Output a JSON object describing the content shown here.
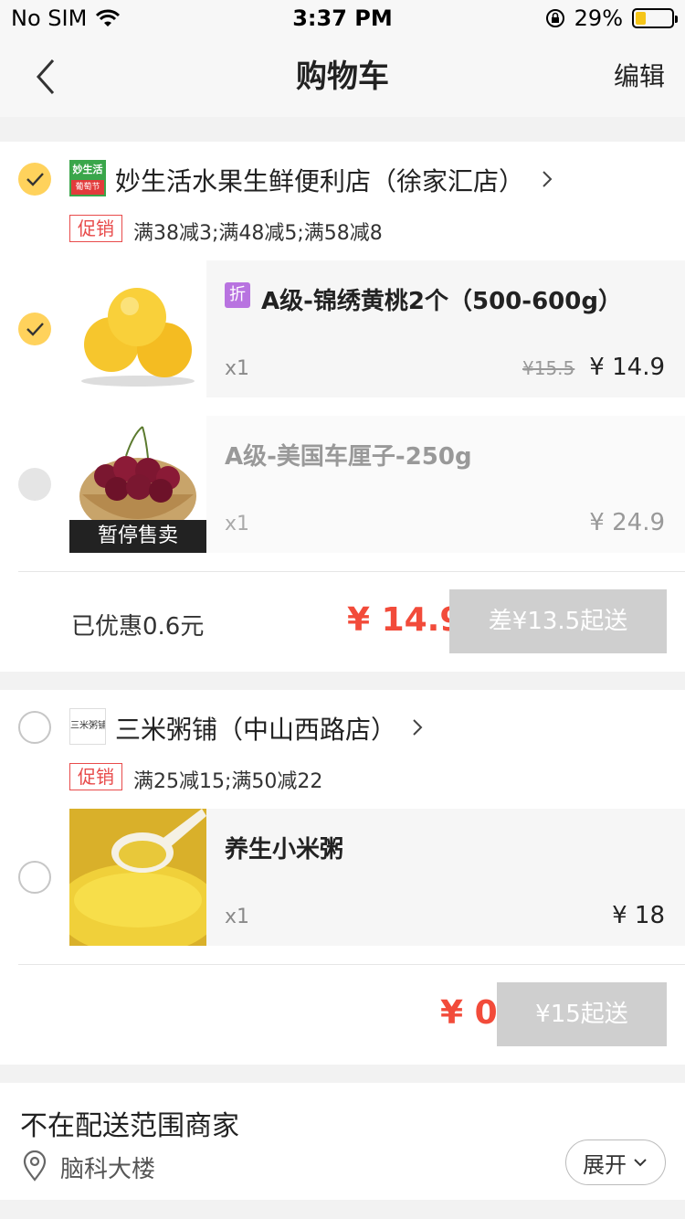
{
  "status": {
    "carrier": "No SIM",
    "time": "3:37 PM",
    "battery": "29%",
    "battery_level": 0.29
  },
  "nav": {
    "title": "购物车",
    "edit": "编辑"
  },
  "stores": [
    {
      "name": "妙生活水果生鲜便利店（徐家汇店）",
      "logo_text": "妙生活",
      "logo_subtext": "葡萄节",
      "promo_tag": "促销",
      "promo": "满38减3;满48减5;满58减8",
      "items": [
        {
          "title": "A级-锦绣黄桃2个（500-600g）",
          "badge": "折",
          "qty": "x1",
          "old_price": "¥15.5",
          "price": "¥ 14.9"
        },
        {
          "title": "A级-美国车厘子-250g",
          "qty": "x1",
          "price": "¥ 24.9",
          "overlay": "暂停售卖"
        }
      ],
      "saving": "已优惠0.6元",
      "total": "¥ 14.9",
      "send": "差¥13.5起送"
    },
    {
      "name": "三米粥铺（中山西路店）",
      "logo_text": "三米粥铺",
      "promo_tag": "促销",
      "promo": "满25减15;满50减22",
      "items": [
        {
          "title": "养生小米粥",
          "qty": "x1",
          "price": "¥ 18"
        }
      ],
      "total": "¥ 0",
      "send": "¥15起送"
    }
  ],
  "out_of_range": {
    "title": "不在配送范围商家",
    "location": "脑科大楼",
    "expand": "展开"
  },
  "colors": {
    "accent": "#ffd25c",
    "price_red": "#f24b3a",
    "promo_red": "#e84b4b",
    "disabled_button": "#cfcfcf"
  }
}
